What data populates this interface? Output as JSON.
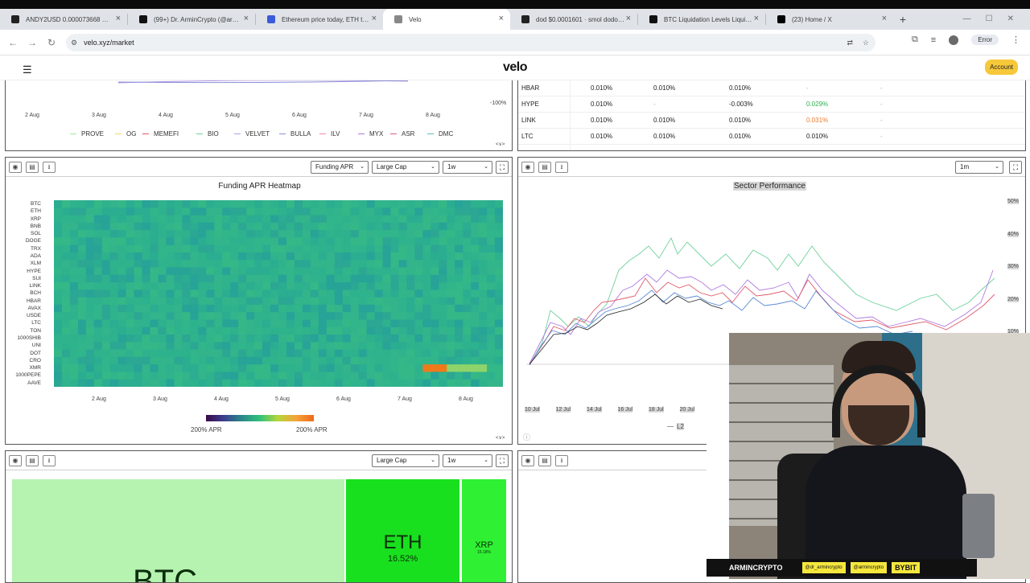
{
  "browser": {
    "tabs": [
      {
        "title": "ANDY2USD 0.000073668 ▲ +4.…",
        "icon_color": "#222222",
        "active": false
      },
      {
        "title": "(99+) Dr. ArminCrypto (@armin…",
        "icon_color": "#111111",
        "active": false
      },
      {
        "title": "Ethereum price today, ETH to U…",
        "icon_color": "#3b5bdb",
        "active": false
      },
      {
        "title": "Velo",
        "icon_color": "#888888",
        "active": true
      },
      {
        "title": "dod $0.0001601 · smol dodo / …",
        "icon_color": "#222222",
        "active": false
      },
      {
        "title": "BTC Liquidation Levels Liquidati…",
        "icon_color": "#111111",
        "active": false
      },
      {
        "title": "(23) Home / X",
        "icon_color": "#000000",
        "active": false
      }
    ],
    "new_tab": "+",
    "url": "velo.xyz/market",
    "error_label": "Error"
  },
  "site": {
    "logo": "velo",
    "account_label": "Account"
  },
  "top_left_panel": {
    "x_labels": [
      "2 Aug",
      "3 Aug",
      "4 Aug",
      "5 Aug",
      "6 Aug",
      "7 Aug",
      "8 Aug"
    ],
    "y_label": "-100%",
    "legend": [
      {
        "name": "PROVE",
        "color": "#a8e6a1"
      },
      {
        "name": "OG",
        "color": "#f5d66b"
      },
      {
        "name": "MEMEFI",
        "color": "#e05a6a"
      },
      {
        "name": "BIO",
        "color": "#6fd19a"
      },
      {
        "name": "VELVET",
        "color": "#b59ae6"
      },
      {
        "name": "BULLA",
        "color": "#8a8fd6"
      },
      {
        "name": "ILV",
        "color": "#f08bb0"
      },
      {
        "name": "MYX",
        "color": "#b07ae0"
      },
      {
        "name": "ASR",
        "color": "#e05a8a"
      },
      {
        "name": "DMC",
        "color": "#5ac0c0"
      }
    ],
    "pager": "<∨>"
  },
  "funding_table": {
    "rows": [
      {
        "sym": "HBAR",
        "c1": "0.010%",
        "c2": "0.010%",
        "c3": "0.010%",
        "c4": "-",
        "c5": "-"
      },
      {
        "sym": "HYPE",
        "c1": "0.010%",
        "c2": "-",
        "c3": "-0.003%",
        "c4": "0.029%",
        "c5": "-"
      },
      {
        "sym": "LINK",
        "c1": "0.010%",
        "c2": "0.010%",
        "c3": "0.010%",
        "c4": "0.031%",
        "c5": "-"
      },
      {
        "sym": "LTC",
        "c1": "0.010%",
        "c2": "0.010%",
        "c3": "0.010%",
        "c4": "0.010%",
        "c5": "-"
      }
    ],
    "highlight_colors": {
      "green": "#2bb24c",
      "orange": "#f07a2a"
    }
  },
  "heatmap_panel": {
    "title": "Funding APR Heatmap",
    "metric_select": "Funding APR",
    "cap_select": "Large Cap",
    "range_select": "1w",
    "coins": [
      "BTC",
      "ETH",
      "XRP",
      "BNB",
      "SOL",
      "DOGE",
      "TRX",
      "ADA",
      "XLM",
      "HYPE",
      "SUI",
      "LINK",
      "BCH",
      "HBAR",
      "AVAX",
      "USDE",
      "LTC",
      "TON",
      "1000SHIB",
      "UNI",
      "DOT",
      "CRO",
      "XMR",
      "1000PEPE",
      "AAVE"
    ],
    "x_labels": [
      "2 Aug",
      "3 Aug",
      "4 Aug",
      "5 Aug",
      "6 Aug",
      "7 Aug",
      "8 Aug"
    ],
    "scale_min": "200% APR",
    "scale_max": "200% APR",
    "base_color": "#2fb38c",
    "pager": "<∨>"
  },
  "sector_panel": {
    "title": "Sector Performance",
    "range_select": "1m",
    "y_labels": [
      "50%",
      "40%",
      "30%",
      "20%",
      "10%"
    ],
    "x_labels": [
      "10 Jul",
      "12 Jul",
      "14 Jul",
      "16 Jul",
      "18 Jul",
      "20 Jul"
    ],
    "legend_visible": "L2"
  },
  "treemap_panel": {
    "cap_select": "Large Cap",
    "range_select": "1w",
    "cells": [
      {
        "sym": "BTC",
        "pct": "",
        "color": "#b6f2b0"
      },
      {
        "sym": "ETH",
        "pct": "16.52%",
        "color": "#19e01e"
      },
      {
        "sym": "XRP",
        "pct": "15.18%",
        "color": "#2ff032"
      }
    ]
  },
  "webcam": {
    "name": "ARMINCRYPTO",
    "tags": [
      "@dr_armincrypto",
      "@armincrypto",
      "BYBIT"
    ]
  }
}
